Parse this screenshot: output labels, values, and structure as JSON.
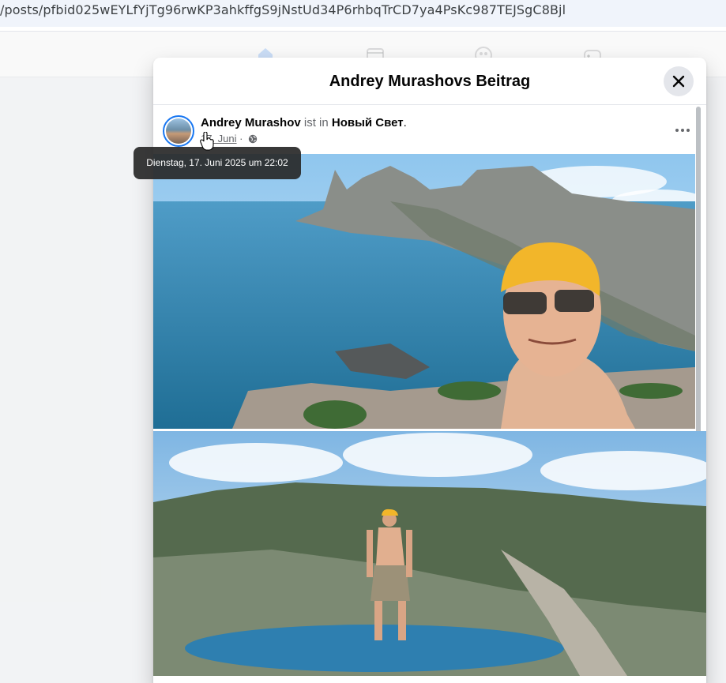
{
  "browser": {
    "url": "/posts/pfbid025wEYLfYjTg96rwKP3ahkffgS9jNstUd34P6rhbqTrCD7ya4PsKc987TEJSgC8Bjl"
  },
  "nav": {
    "icons": [
      "home-icon",
      "video-icon",
      "groups-icon",
      "gaming-icon"
    ]
  },
  "modal": {
    "title": "Andrey Murashovs Beitrag"
  },
  "post": {
    "author": "Andrey Murashov",
    "location_prefix": " ist in ",
    "location": "Новый Свет",
    "location_suffix": ".",
    "date": "17. Juni",
    "separator": " · ",
    "privacy_icon": "globe-icon"
  },
  "tooltip": {
    "text": "Dienstag, 17. Juni 2025 um 22:02"
  },
  "colors": {
    "accent": "#1877f2",
    "muted_text": "#65676b",
    "tooltip_bg": "#282828"
  }
}
